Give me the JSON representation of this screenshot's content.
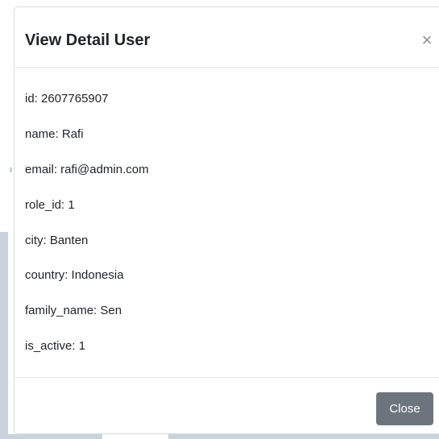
{
  "modal": {
    "title": "View Detail User",
    "close_glyph": "×",
    "fields": [
      "id: 2607765907",
      "name: Rafi",
      "email: rafi@admin.com",
      "role_id: 1",
      "city: Banten",
      "country: Indonesia",
      "family_name: Sen",
      "is_active: 1"
    ],
    "footer": {
      "close_label": "Close"
    }
  },
  "colors": {
    "button_secondary": "#6c757d",
    "backdrop_panel": "#c8d3dd"
  }
}
